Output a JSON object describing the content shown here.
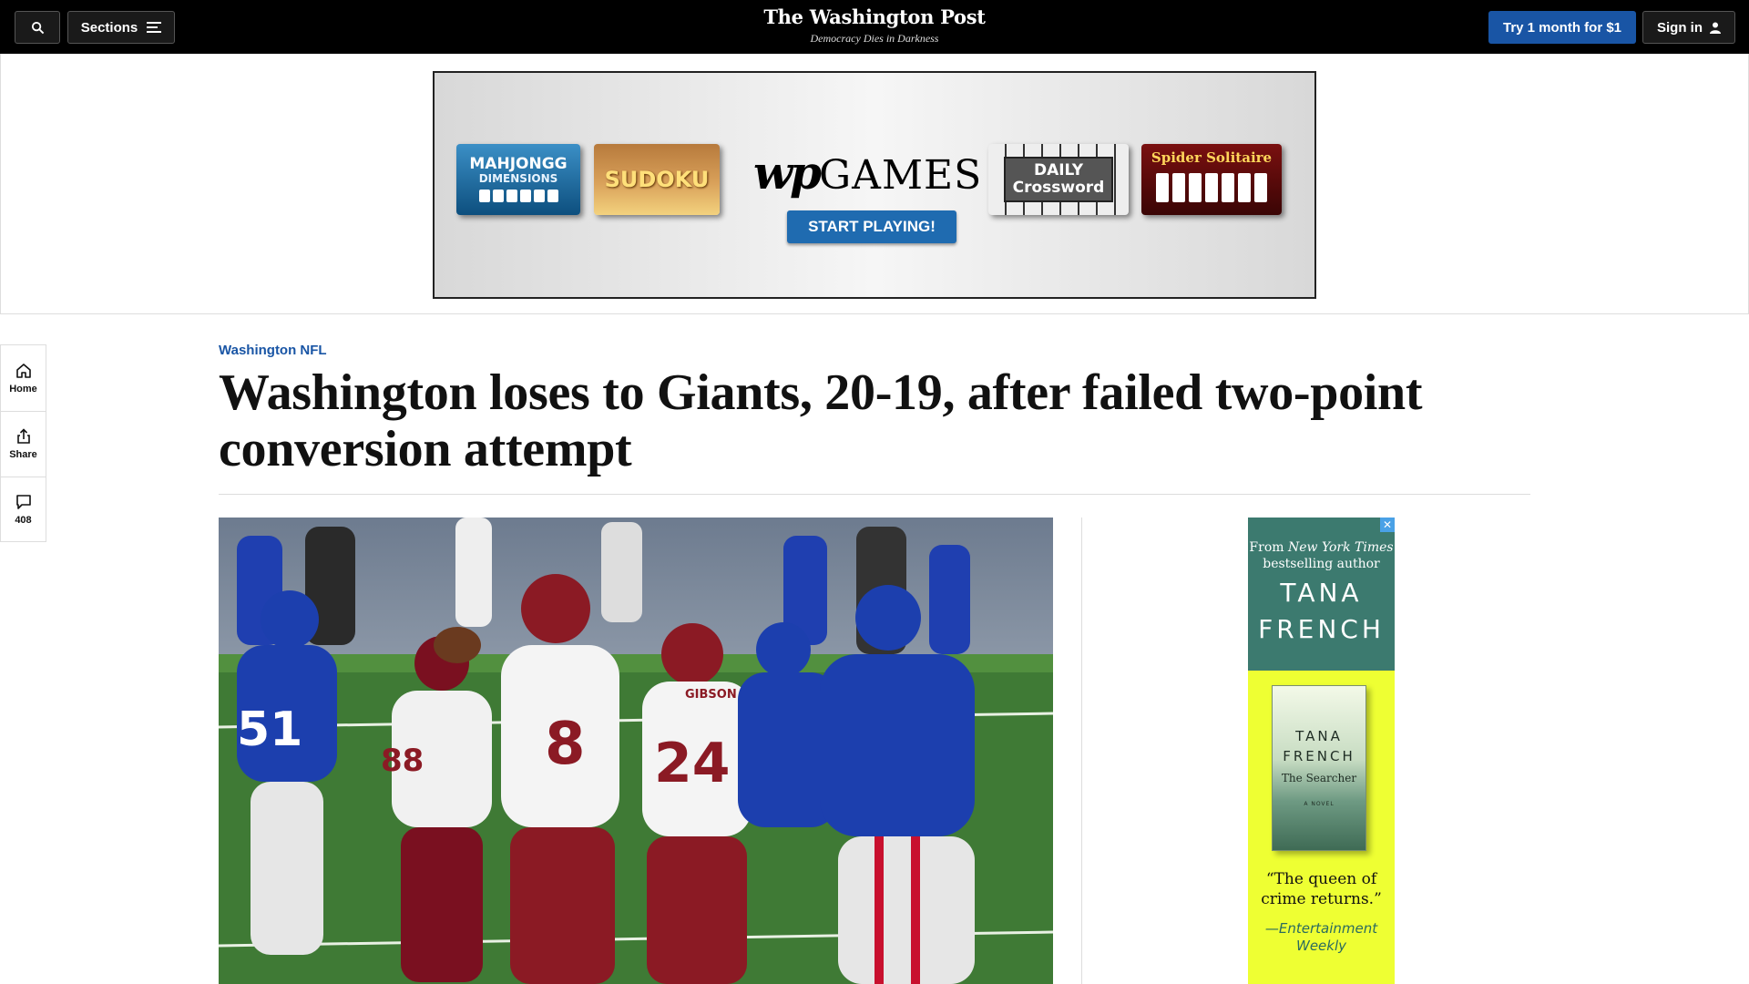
{
  "topbar": {
    "search_icon": "search-icon",
    "sections_label": "Sections",
    "masthead_title": "The Washington Post",
    "masthead_tagline": "Democracy Dies in Darkness",
    "subscribe_label": "Try 1 month for $1",
    "signin_label": "Sign in"
  },
  "ad_banner": {
    "tiles": {
      "mahjongg_line1": "MAHJONGG",
      "mahjongg_line2": "DIMENSIONS",
      "sudoku": "SUDOKU",
      "crossword_line1": "DAILY",
      "crossword_line2": "Crossword",
      "spider": "Spider Solitaire"
    },
    "logo_wp": "wp",
    "logo_games": "GAMES",
    "cta": "START PLAYING!"
  },
  "left_rail": {
    "home_label": "Home",
    "share_label": "Share",
    "comments_count": "408"
  },
  "article": {
    "kicker": "Washington NFL",
    "headline": "Washington loses to Giants, 20-19, after failed two-point conversion attempt"
  },
  "side_ad": {
    "from_line1": "From",
    "from_pub": "New York Times",
    "from_line2": "bestselling author",
    "author_line1": "TANA",
    "author_line2": "FRENCH",
    "book_author": "TANA FRENCH",
    "book_title": "The Searcher",
    "book_novel": "A NOVEL",
    "quote": "“The queen of crime returns.”",
    "attribution": "—Entertainment Weekly",
    "close": "✕"
  },
  "colors": {
    "topbar_bg": "#000000",
    "accent_blue": "#1955a5",
    "field_green": "#4a7a3e",
    "giants_blue": "#1f3fb0",
    "wft_burgundy": "#7a1020",
    "ad_yellow": "#eeff33"
  }
}
